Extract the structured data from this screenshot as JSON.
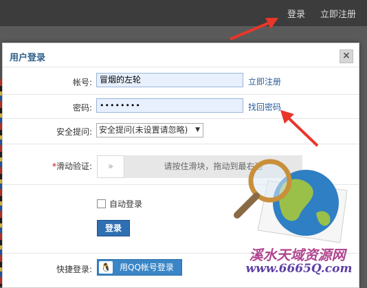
{
  "topbar": {
    "login_link": "登录",
    "register_link": "立即注册"
  },
  "dialog": {
    "title": "用户登录",
    "close_icon": "close-icon",
    "account": {
      "label": "帐号:",
      "value": "冒烟的左轮",
      "link": "立即注册"
    },
    "password": {
      "label": "密码:",
      "value": "••••••••",
      "link": "找回密码"
    },
    "security_question": {
      "label": "安全提问:",
      "selected": "安全提问(未设置请忽略)"
    },
    "slide_verify": {
      "required_mark": "*",
      "label": "滑动验证:",
      "handle_icon": "double-chevron-right-icon",
      "hint": "请按住滑块，拖动到最右边"
    },
    "auto_login": {
      "label": "自动登录",
      "checked": false
    },
    "login_button": "登录",
    "quick_login": {
      "label": "快捷登录:",
      "qq_button": "用QQ帐号登录",
      "qq_icon": "qq-penguin-icon"
    }
  },
  "watermark": {
    "text": "溪水天域资源网",
    "url": "www.6665Q.com",
    "graphic": "magnifier-globe-icon"
  },
  "colors": {
    "accent": "#2f6fb3",
    "arrow": "#e8362a",
    "link": "#2a5c9a"
  }
}
